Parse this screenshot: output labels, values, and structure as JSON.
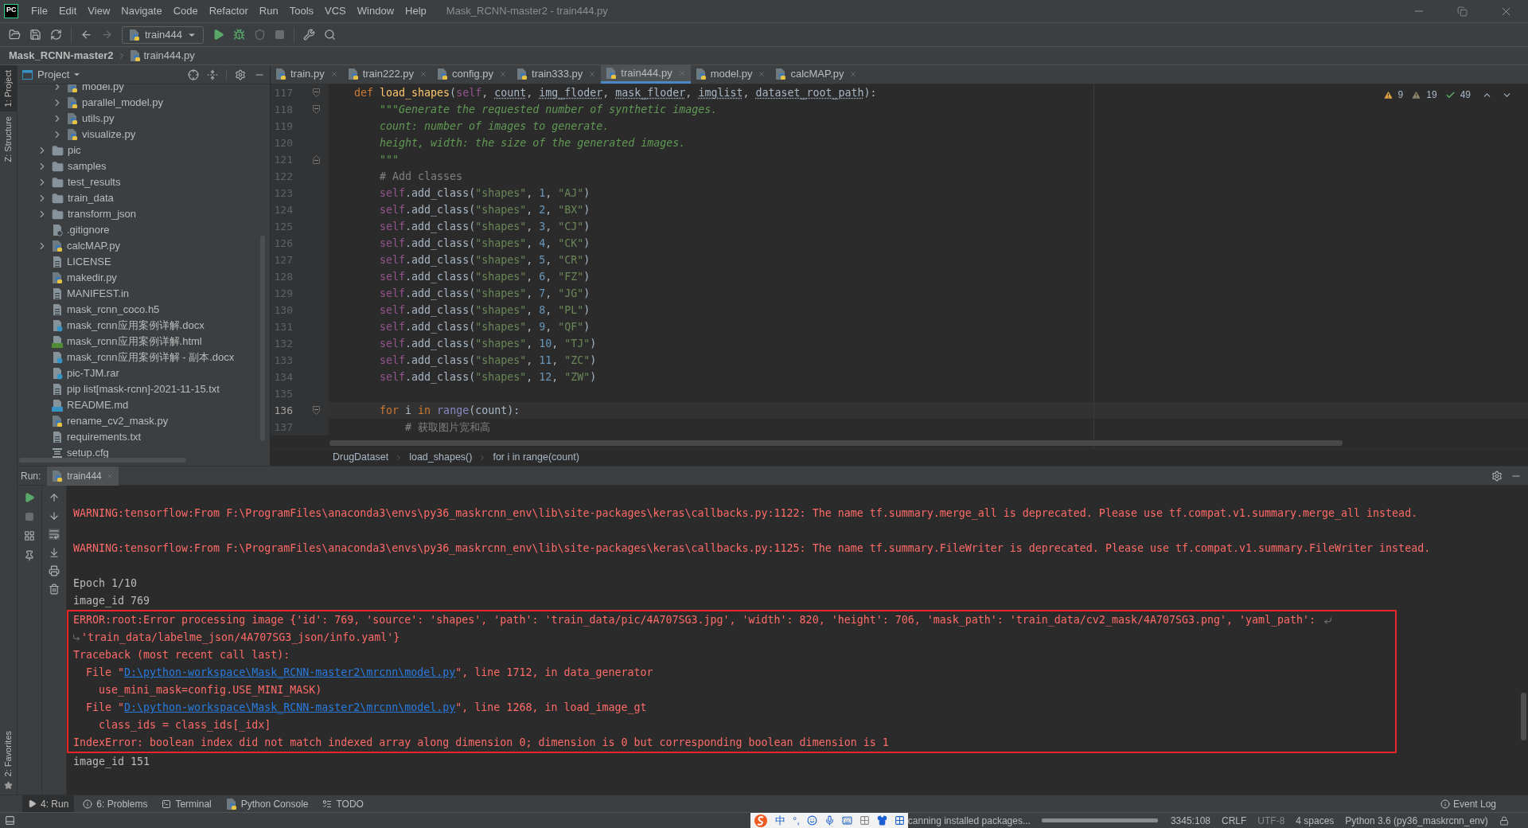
{
  "window": {
    "logo": "PC",
    "title": "Mask_RCNN-master2 - train444.py"
  },
  "menu": [
    "File",
    "Edit",
    "View",
    "Navigate",
    "Code",
    "Refactor",
    "Run",
    "Tools",
    "VCS",
    "Window",
    "Help"
  ],
  "toolbar": {
    "run_config": "train444"
  },
  "nav_bar": {
    "project": "Mask_RCNN-master2",
    "file": "train444.py"
  },
  "left_stripe": [
    {
      "label": "1: Project",
      "selected": true
    },
    {
      "label": "Z: Structure",
      "selected": false
    }
  ],
  "favorites_stripe": {
    "label": "2: Favorites"
  },
  "project_panel": {
    "title": "Project",
    "tree": [
      {
        "children": [
          {
            "label": "model.py",
            "kind": "python",
            "expanded": false
          },
          {
            "label": "parallel_model.py",
            "kind": "python",
            "expanded": false
          },
          {
            "label": "utils.py",
            "kind": "python",
            "expanded": false
          },
          {
            "label": "visualize.py",
            "kind": "python",
            "expanded": false
          }
        ]
      },
      {
        "label": "pic",
        "kind": "folder",
        "expanded": false
      },
      {
        "label": "samples",
        "kind": "folder",
        "expanded": false
      },
      {
        "label": "test_results",
        "kind": "folder",
        "expanded": false
      },
      {
        "label": "train_data",
        "kind": "folder",
        "expanded": false
      },
      {
        "label": "transform_json",
        "kind": "folder",
        "expanded": false
      },
      {
        "label": ".gitignore",
        "kind": "ignore"
      },
      {
        "label": "calcMAP.py",
        "kind": "python",
        "expanded": false
      },
      {
        "label": "LICENSE",
        "kind": "text"
      },
      {
        "label": "makedir.py",
        "kind": "python"
      },
      {
        "label": "MANIFEST.in",
        "kind": "text"
      },
      {
        "label": "mask_rcnn_coco.h5",
        "kind": "text"
      },
      {
        "label": "mask_rcnn应用案例详解.docx",
        "kind": "unknown"
      },
      {
        "label": "mask_rcnn应用案例详解.html",
        "kind": "html"
      },
      {
        "label": "mask_rcnn应用案例详解 - 副本.docx",
        "kind": "unknown"
      },
      {
        "label": "pic-TJM.rar",
        "kind": "unknown"
      },
      {
        "label": "pip list[mask-rcnn]-2021-11-15.txt",
        "kind": "text"
      },
      {
        "label": "README.md",
        "kind": "markdown"
      },
      {
        "label": "rename_cv2_mask.py",
        "kind": "python"
      },
      {
        "label": "requirements.txt",
        "kind": "text"
      },
      {
        "label": "setup.cfg",
        "kind": "config"
      }
    ]
  },
  "editor": {
    "tabs": [
      {
        "label": "train.py",
        "selected": false
      },
      {
        "label": "train222.py",
        "selected": false
      },
      {
        "label": "config.py",
        "selected": false
      },
      {
        "label": "train333.py",
        "selected": false
      },
      {
        "label": "train444.py",
        "selected": true
      },
      {
        "label": "model.py",
        "selected": false
      },
      {
        "label": "calcMAP.py",
        "selected": false
      }
    ],
    "inspections": {
      "warnings": "9",
      "weak_warnings": "19",
      "typos": "49"
    },
    "lines": [
      {
        "number": "117",
        "current": false,
        "kind": "fold_start",
        "tokens": [
          {
            "kind": "keyword",
            "text": "    def "
          },
          {
            "kind": "function",
            "text": "load_shapes"
          },
          {
            "kind": "plain",
            "text": "("
          },
          {
            "kind": "self",
            "text": "self"
          },
          {
            "kind": "plain",
            "text": ", "
          },
          {
            "kind": "param",
            "text": "count"
          },
          {
            "kind": "plain",
            "text": ", "
          },
          {
            "kind": "param",
            "text": "img_floder"
          },
          {
            "kind": "plain",
            "text": ", "
          },
          {
            "kind": "param",
            "text": "mask_floder"
          },
          {
            "kind": "plain",
            "text": ", "
          },
          {
            "kind": "param",
            "text": "imglist"
          },
          {
            "kind": "plain",
            "text": ", "
          },
          {
            "kind": "param",
            "text": "dataset_root_path"
          },
          {
            "kind": "plain",
            "text": "):"
          }
        ]
      },
      {
        "number": "118",
        "current": false,
        "kind": "fold_start",
        "tokens": [
          {
            "kind": "doc",
            "text": "        \"\"\"Generate the requested number of synthetic images."
          }
        ]
      },
      {
        "number": "119",
        "current": false,
        "tokens": [
          {
            "kind": "doc",
            "text": "        count: number of images to generate."
          }
        ]
      },
      {
        "number": "120",
        "current": false,
        "tokens": [
          {
            "kind": "doc",
            "text": "        height, width: the size of the generated images."
          }
        ]
      },
      {
        "number": "121",
        "current": false,
        "kind": "fold_end",
        "tokens": [
          {
            "kind": "doc",
            "text": "        \"\"\""
          }
        ]
      },
      {
        "number": "122",
        "current": false,
        "tokens": [
          {
            "kind": "comment",
            "text": "        # Add classes"
          }
        ]
      },
      {
        "number": "123",
        "current": false,
        "tokens": [
          {
            "kind": "self",
            "text": "        self"
          },
          {
            "kind": "plain",
            "text": ".add_class("
          },
          {
            "kind": "string",
            "text": "\"shapes\""
          },
          {
            "kind": "plain",
            "text": ", "
          },
          {
            "kind": "number",
            "text": "1"
          },
          {
            "kind": "plain",
            "text": ", "
          },
          {
            "kind": "string",
            "text": "\"AJ\""
          },
          {
            "kind": "plain",
            "text": ")"
          }
        ]
      },
      {
        "number": "124",
        "current": false,
        "tokens": [
          {
            "kind": "self",
            "text": "        self"
          },
          {
            "kind": "plain",
            "text": ".add_class("
          },
          {
            "kind": "string",
            "text": "\"shapes\""
          },
          {
            "kind": "plain",
            "text": ", "
          },
          {
            "kind": "number",
            "text": "2"
          },
          {
            "kind": "plain",
            "text": ", "
          },
          {
            "kind": "string",
            "text": "\"BX\""
          },
          {
            "kind": "plain",
            "text": ")"
          }
        ]
      },
      {
        "number": "125",
        "current": false,
        "tokens": [
          {
            "kind": "self",
            "text": "        self"
          },
          {
            "kind": "plain",
            "text": ".add_class("
          },
          {
            "kind": "string",
            "text": "\"shapes\""
          },
          {
            "kind": "plain",
            "text": ", "
          },
          {
            "kind": "number",
            "text": "3"
          },
          {
            "kind": "plain",
            "text": ", "
          },
          {
            "kind": "string",
            "text": "\"CJ\""
          },
          {
            "kind": "plain",
            "text": ")"
          }
        ]
      },
      {
        "number": "126",
        "current": false,
        "tokens": [
          {
            "kind": "self",
            "text": "        self"
          },
          {
            "kind": "plain",
            "text": ".add_class("
          },
          {
            "kind": "string",
            "text": "\"shapes\""
          },
          {
            "kind": "plain",
            "text": ", "
          },
          {
            "kind": "number",
            "text": "4"
          },
          {
            "kind": "plain",
            "text": ", "
          },
          {
            "kind": "string",
            "text": "\"CK\""
          },
          {
            "kind": "plain",
            "text": ")"
          }
        ]
      },
      {
        "number": "127",
        "current": false,
        "tokens": [
          {
            "kind": "self",
            "text": "        self"
          },
          {
            "kind": "plain",
            "text": ".add_class("
          },
          {
            "kind": "string",
            "text": "\"shapes\""
          },
          {
            "kind": "plain",
            "text": ", "
          },
          {
            "kind": "number",
            "text": "5"
          },
          {
            "kind": "plain",
            "text": ", "
          },
          {
            "kind": "string",
            "text": "\"CR\""
          },
          {
            "kind": "plain",
            "text": ")"
          }
        ]
      },
      {
        "number": "128",
        "current": false,
        "tokens": [
          {
            "kind": "self",
            "text": "        self"
          },
          {
            "kind": "plain",
            "text": ".add_class("
          },
          {
            "kind": "string",
            "text": "\"shapes\""
          },
          {
            "kind": "plain",
            "text": ", "
          },
          {
            "kind": "number",
            "text": "6"
          },
          {
            "kind": "plain",
            "text": ", "
          },
          {
            "kind": "string",
            "text": "\"FZ\""
          },
          {
            "kind": "plain",
            "text": ")"
          }
        ]
      },
      {
        "number": "129",
        "current": false,
        "tokens": [
          {
            "kind": "self",
            "text": "        self"
          },
          {
            "kind": "plain",
            "text": ".add_class("
          },
          {
            "kind": "string",
            "text": "\"shapes\""
          },
          {
            "kind": "plain",
            "text": ", "
          },
          {
            "kind": "number",
            "text": "7"
          },
          {
            "kind": "plain",
            "text": ", "
          },
          {
            "kind": "string",
            "text": "\"JG\""
          },
          {
            "kind": "plain",
            "text": ")"
          }
        ]
      },
      {
        "number": "130",
        "current": false,
        "tokens": [
          {
            "kind": "self",
            "text": "        self"
          },
          {
            "kind": "plain",
            "text": ".add_class("
          },
          {
            "kind": "string",
            "text": "\"shapes\""
          },
          {
            "kind": "plain",
            "text": ", "
          },
          {
            "kind": "number",
            "text": "8"
          },
          {
            "kind": "plain",
            "text": ", "
          },
          {
            "kind": "string",
            "text": "\"PL\""
          },
          {
            "kind": "plain",
            "text": ")"
          }
        ]
      },
      {
        "number": "131",
        "current": false,
        "tokens": [
          {
            "kind": "self",
            "text": "        self"
          },
          {
            "kind": "plain",
            "text": ".add_class("
          },
          {
            "kind": "string",
            "text": "\"shapes\""
          },
          {
            "kind": "plain",
            "text": ", "
          },
          {
            "kind": "number",
            "text": "9"
          },
          {
            "kind": "plain",
            "text": ", "
          },
          {
            "kind": "string",
            "text": "\"QF\""
          },
          {
            "kind": "plain",
            "text": ")"
          }
        ]
      },
      {
        "number": "132",
        "current": false,
        "tokens": [
          {
            "kind": "self",
            "text": "        self"
          },
          {
            "kind": "plain",
            "text": ".add_class("
          },
          {
            "kind": "string",
            "text": "\"shapes\""
          },
          {
            "kind": "plain",
            "text": ", "
          },
          {
            "kind": "number",
            "text": "10"
          },
          {
            "kind": "plain",
            "text": ", "
          },
          {
            "kind": "string",
            "text": "\"TJ\""
          },
          {
            "kind": "plain",
            "text": ")"
          }
        ]
      },
      {
        "number": "133",
        "current": false,
        "tokens": [
          {
            "kind": "self",
            "text": "        self"
          },
          {
            "kind": "plain",
            "text": ".add_class("
          },
          {
            "kind": "string",
            "text": "\"shapes\""
          },
          {
            "kind": "plain",
            "text": ", "
          },
          {
            "kind": "number",
            "text": "11"
          },
          {
            "kind": "plain",
            "text": ", "
          },
          {
            "kind": "string",
            "text": "\"ZC\""
          },
          {
            "kind": "plain",
            "text": ")"
          }
        ]
      },
      {
        "number": "134",
        "current": false,
        "tokens": [
          {
            "kind": "self",
            "text": "        self"
          },
          {
            "kind": "plain",
            "text": ".add_class("
          },
          {
            "kind": "string",
            "text": "\"shapes\""
          },
          {
            "kind": "plain",
            "text": ", "
          },
          {
            "kind": "number",
            "text": "12"
          },
          {
            "kind": "plain",
            "text": ", "
          },
          {
            "kind": "string",
            "text": "\"ZW\""
          },
          {
            "kind": "plain",
            "text": ")"
          }
        ]
      },
      {
        "number": "135",
        "current": false
      },
      {
        "number": "136",
        "current": true,
        "kind": "fold_start",
        "tokens": [
          {
            "kind": "keyword",
            "text": "        for"
          },
          {
            "kind": "plain",
            "text": " i "
          },
          {
            "kind": "keyword",
            "text": "in"
          },
          {
            "kind": "builtin",
            "text": " range"
          },
          {
            "kind": "plain",
            "text": "(count):"
          }
        ]
      },
      {
        "number": "137",
        "current": false,
        "tokens": [
          {
            "kind": "comment",
            "text": "            # 获取图片宽和高"
          }
        ]
      }
    ],
    "breadcrumbs": [
      "DrugDataset",
      "load_shapes()",
      "for i in range(count)"
    ]
  },
  "run_panel": {
    "label": "Run:",
    "tab": "train444",
    "console": [
      {
        "kind": "error",
        "text": "WARNING:tensorflow:From F:\\ProgramFiles\\anaconda3\\envs\\py36_maskrcnn_env\\lib\\site-packages\\keras\\callbacks.py:1122: The name tf.summary.merge_all is deprecated. Please use tf.compat.v1.summary.merge_all instead."
      },
      {
        "kind": "blank"
      },
      {
        "kind": "error",
        "text": "WARNING:tensorflow:From F:\\ProgramFiles\\anaconda3\\envs\\py36_maskrcnn_env\\lib\\site-packages\\keras\\callbacks.py:1125: The name tf.summary.FileWriter is deprecated. Please use tf.compat.v1.summary.FileWriter instead."
      },
      {
        "kind": "blank"
      },
      {
        "kind": "output",
        "text": "Epoch 1/10"
      },
      {
        "kind": "output",
        "text": "image_id 769"
      },
      {
        "kind": "box",
        "children": [
          {
            "kind": "wrapped",
            "text": "ERROR:root:Error processing image {'id': 769, 'source': 'shapes', 'path': 'train_data/pic/4A707SG3.jpg', 'width': 820, 'height': 706, 'mask_path': 'train_data/cv2_mask/4A707SG3.png', 'yaml_path': "
          },
          {
            "kind": "continued",
            "text": "'train_data/labelme_json/4A707SG3_json/info.yaml'}"
          },
          {
            "kind": "error",
            "text": "Traceback (most recent call last):"
          },
          {
            "kind": "file",
            "prefix": "  File \"",
            "link": "D:\\python-workspace\\Mask_RCNN-master2\\mrcnn\\model.py",
            "suffix": "\", line 1712, in data_generator"
          },
          {
            "kind": "error",
            "text": "    use_mini_mask=config.USE_MINI_MASK)"
          },
          {
            "kind": "file",
            "prefix": "  File \"",
            "link": "D:\\python-workspace\\Mask_RCNN-master2\\mrcnn\\model.py",
            "suffix": "\", line 1268, in load_image_gt"
          },
          {
            "kind": "error",
            "text": "    class_ids = class_ids[_idx]"
          },
          {
            "kind": "error",
            "text": "IndexError: boolean index did not match indexed array along dimension 0; dimension is 0 but corresponding boolean dimension is 1"
          }
        ]
      },
      {
        "kind": "output",
        "text": "image_id 151"
      }
    ]
  },
  "bottom_tabs": [
    {
      "label": "4: Run",
      "kind": "run",
      "selected": true
    },
    {
      "label": "6: Problems",
      "kind": "info",
      "selected": false
    },
    {
      "label": "Terminal",
      "kind": "terminal",
      "selected": false
    },
    {
      "label": "Python Console",
      "kind": "python",
      "selected": false
    },
    {
      "label": "TODO",
      "kind": "list",
      "selected": false
    }
  ],
  "event_log": "Event Log",
  "status_bar": {
    "ime": [
      "中",
      "°,"
    ],
    "task": "canning installed packages...",
    "progress": {
      "level": 1
    },
    "position": "3345:108",
    "line_separator": "CRLF",
    "encoding": "UTF-8",
    "indent": "4 spaces",
    "interpreter": "Python 3.6 (py36_maskrcnn_env)"
  }
}
